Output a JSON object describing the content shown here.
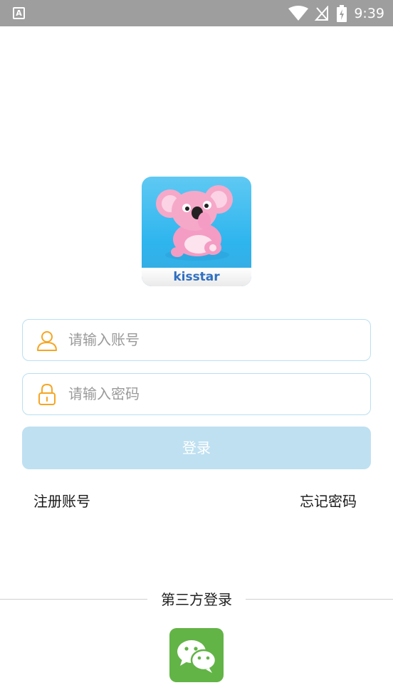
{
  "status_bar": {
    "left_icon": "A",
    "time": "9:39",
    "icons": [
      "wifi-icon",
      "no-signal-icon",
      "battery-charging-icon"
    ]
  },
  "logo": {
    "brand_text": "kisstar",
    "icon": "koala-mascot"
  },
  "account_field": {
    "placeholder": "请输入账号",
    "value": "",
    "icon": "user-icon"
  },
  "password_field": {
    "placeholder": "请输入密码",
    "value": "",
    "icon": "lock-icon"
  },
  "login_button": {
    "label": "登录"
  },
  "links": {
    "register": "注册账号",
    "forgot_password": "忘记密码"
  },
  "third_party": {
    "label": "第三方登录",
    "providers": [
      "wechat-icon"
    ]
  },
  "colors": {
    "status_bar_bg": "#9e9e9e",
    "input_border": "#b9dff0",
    "icon_orange": "#f5a623",
    "login_button_disabled": "#bfe0f1",
    "wechat_green": "#62b446"
  }
}
